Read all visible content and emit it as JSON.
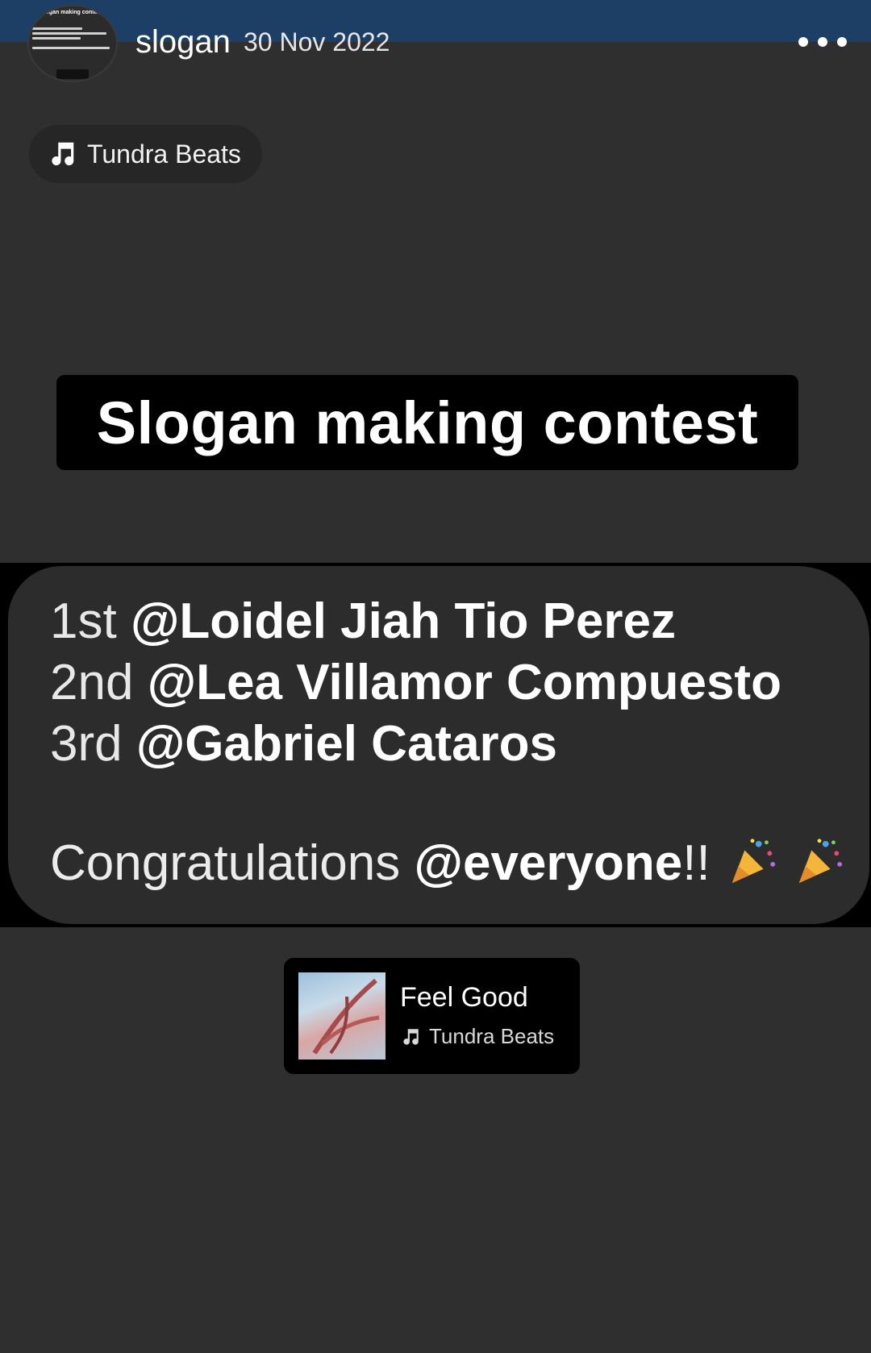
{
  "header": {
    "username": "slogan",
    "date": "30 Nov 2022",
    "more_icon": "more-horizontal-icon"
  },
  "music_chip": {
    "label": "Tundra Beats",
    "icon": "music-note-icon"
  },
  "post": {
    "title": "Slogan making contest",
    "results": [
      {
        "rank": "1st",
        "mention": "@Loidel Jiah Tio Perez"
      },
      {
        "rank": "2nd",
        "mention": "@Lea Villamor Compuesto"
      },
      {
        "rank": "3rd",
        "mention": "@Gabriel Cataros"
      }
    ],
    "congrats_text": "Congratulations ",
    "congrats_mention": "@everyone",
    "congrats_suffix": "!!",
    "emoji": "party-popper-icon"
  },
  "song_card": {
    "title": "Feel Good",
    "artist": "Tundra Beats",
    "icon": "music-note-icon"
  },
  "colors": {
    "background": "#2f2f30",
    "top_strip": "#1d3f66",
    "title_box": "#000000",
    "bubble": "#2c2c2d"
  }
}
